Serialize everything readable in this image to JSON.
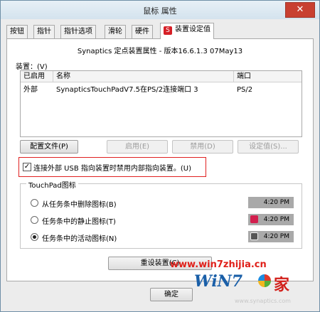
{
  "window": {
    "title": "鼠标 属性",
    "close_symbol": "✕"
  },
  "tabs": [
    {
      "label": "按钮"
    },
    {
      "label": "指针"
    },
    {
      "label": "指针选项"
    },
    {
      "label": "滑轮"
    },
    {
      "label": "硬件"
    },
    {
      "label": "装置设定值",
      "active": true
    }
  ],
  "panel": {
    "header": "Synaptics 定点装置属性 - 版本16.6.1.3 07May13",
    "devices_label": "装置：(V)",
    "table": {
      "headers": [
        "已启用",
        "名称",
        "端口"
      ],
      "rows": [
        {
          "enabled": "外部",
          "name": "SynapticsTouchPadV7.5在PS/2连接端口 3",
          "port": "PS/2"
        }
      ]
    },
    "buttons": {
      "profile": "配置文件(P)",
      "enable": "启用(E)",
      "disable": "禁用(D)",
      "settings": "设定值(S)..."
    },
    "usb_checkbox": {
      "checked": true,
      "mark": "✓",
      "label": "连接外部 USB 指向装置时禁用内部指向装置。(U)"
    },
    "touchpad_group": {
      "title": "TouchPad图标",
      "options": [
        {
          "label": "从任务条中删除图标(B)",
          "checked": false,
          "time": "4:20 PM",
          "icon": "none"
        },
        {
          "label": "任务条中的静止图标(T)",
          "checked": false,
          "time": "4:20 PM",
          "icon": "touchpad-red-icon"
        },
        {
          "label": "任务条中的活动图标(N)",
          "checked": true,
          "time": "4:20 PM",
          "icon": "touchpad-gray-icon"
        }
      ]
    },
    "reset_button": "重设装置(C)"
  },
  "footer": {
    "ok_button": "确定"
  },
  "watermark": {
    "url": "www.win7zhijia.cn",
    "faint_url": "www.synaptics.com",
    "brand_text": "WiN7",
    "brand_jia": "家"
  },
  "colors": {
    "highlight_box": "#e02020",
    "watermark": "#e0201a",
    "brand_blue": "#1a5fa8"
  }
}
